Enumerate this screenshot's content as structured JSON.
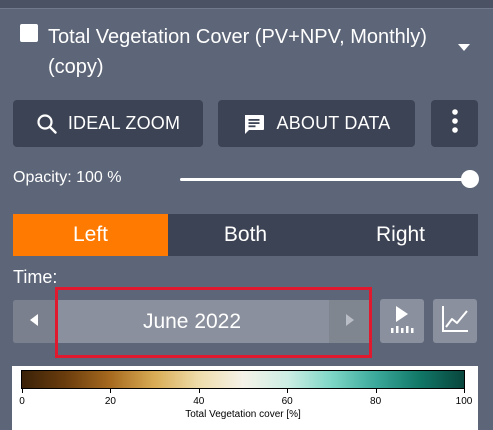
{
  "layer": {
    "title": "Total Vegetation Cover (PV+NPV, Monthly) (copy)",
    "checked": true
  },
  "buttons": {
    "ideal_zoom": "IDEAL ZOOM",
    "about_data": "ABOUT DATA"
  },
  "opacity": {
    "label": "Opacity: 100 %",
    "value": 100
  },
  "compare": {
    "options": [
      "Left",
      "Both",
      "Right"
    ],
    "selected": "Left"
  },
  "time": {
    "label": "Time:",
    "current": "June 2022"
  },
  "legend": {
    "ticks": [
      "0",
      "20",
      "40",
      "60",
      "80",
      "100"
    ],
    "title": "Total Vegetation cover [%]"
  },
  "colors": {
    "active": "#ff7a00",
    "highlight": "#e0192f",
    "panel": "#5d6678",
    "button": "#3c4354"
  },
  "icons": {
    "zoom": "search-icon",
    "about": "message-icon",
    "more": "more-vertical-icon",
    "play": "play-animation-icon",
    "chart": "line-chart-icon"
  }
}
